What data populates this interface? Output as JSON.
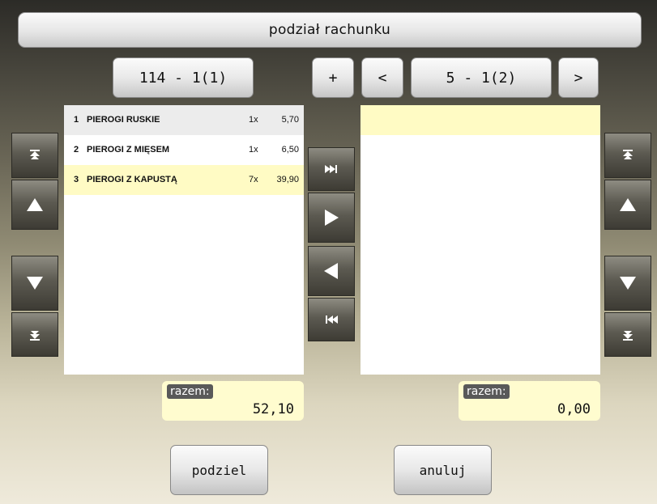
{
  "title": "podział rachunku",
  "left_bill": {
    "label": "114 - 1(1)",
    "total_label": "razem:",
    "total": "52,10"
  },
  "right_bill": {
    "add_label": "+",
    "prev_label": "<",
    "label": "5 - 1(2)",
    "next_label": ">",
    "total_label": "razem:",
    "total": "0,00"
  },
  "left_items": [
    {
      "num": "1",
      "name": "PIEROGI RUSKIE",
      "qty": "1x",
      "price": "5,70"
    },
    {
      "num": "2",
      "name": "PIEROGI Z MIĘSEM",
      "qty": "1x",
      "price": "6,50"
    },
    {
      "num": "3",
      "name": "PIEROGI Z KAPUSTĄ",
      "qty": "7x",
      "price": "39,90"
    }
  ],
  "icons": {
    "first": "scroll-first-icon",
    "up": "arrow-up-icon",
    "down": "arrow-down-icon",
    "last": "scroll-last-icon",
    "move_all_right": "move-all-right-icon",
    "move_right": "move-right-icon",
    "move_left": "move-left-icon",
    "move_all_left": "move-all-left-icon"
  },
  "colors": {
    "selected_row": "#fffbc4",
    "hover_row": "#ececec",
    "total_bg": "#fffccf"
  },
  "buttons": {
    "split": "podziel",
    "cancel": "anuluj"
  }
}
